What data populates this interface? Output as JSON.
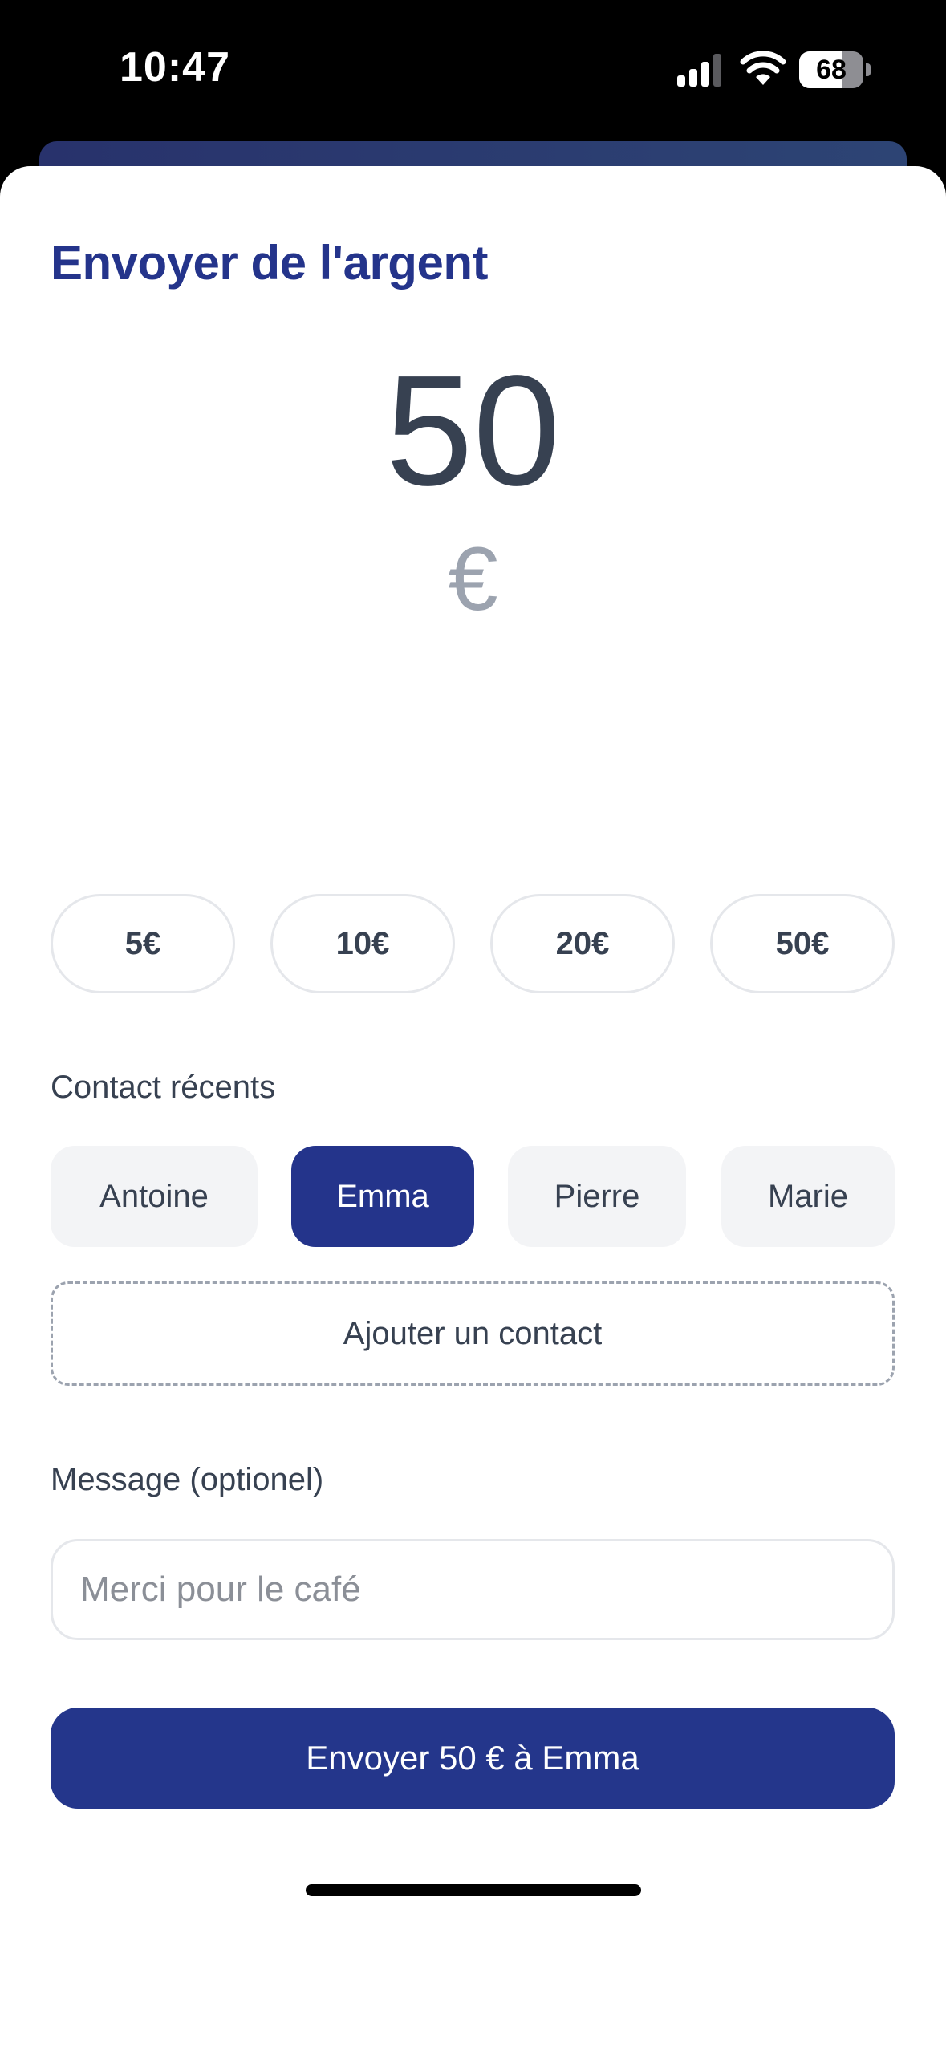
{
  "status_bar": {
    "time": "10:47",
    "battery_level": "68",
    "battery_fraction": 0.68,
    "icons": [
      "signal-icon",
      "wifi-icon",
      "battery-icon"
    ]
  },
  "sheet": {
    "title": "Envoyer de l'argent"
  },
  "amount": {
    "value": "50",
    "currency": "€"
  },
  "quick_amounts": [
    "5€",
    "10€",
    "20€",
    "50€"
  ],
  "contacts": {
    "label": "Contact récents",
    "items": [
      {
        "name": "Antoine",
        "selected": false
      },
      {
        "name": "Emma",
        "selected": true
      },
      {
        "name": "Pierre",
        "selected": false
      },
      {
        "name": "Marie",
        "selected": false
      }
    ],
    "add_label": "Ajouter un contact"
  },
  "message": {
    "label": "Message (optionel)",
    "placeholder": "Merci pour le café",
    "value": ""
  },
  "send_button": {
    "label": "Envoyer 50 € à Emma"
  },
  "colors": {
    "brand": "#24348b",
    "text": "#374151",
    "muted": "#9ca3af",
    "chip_bg": "#f3f4f6"
  }
}
